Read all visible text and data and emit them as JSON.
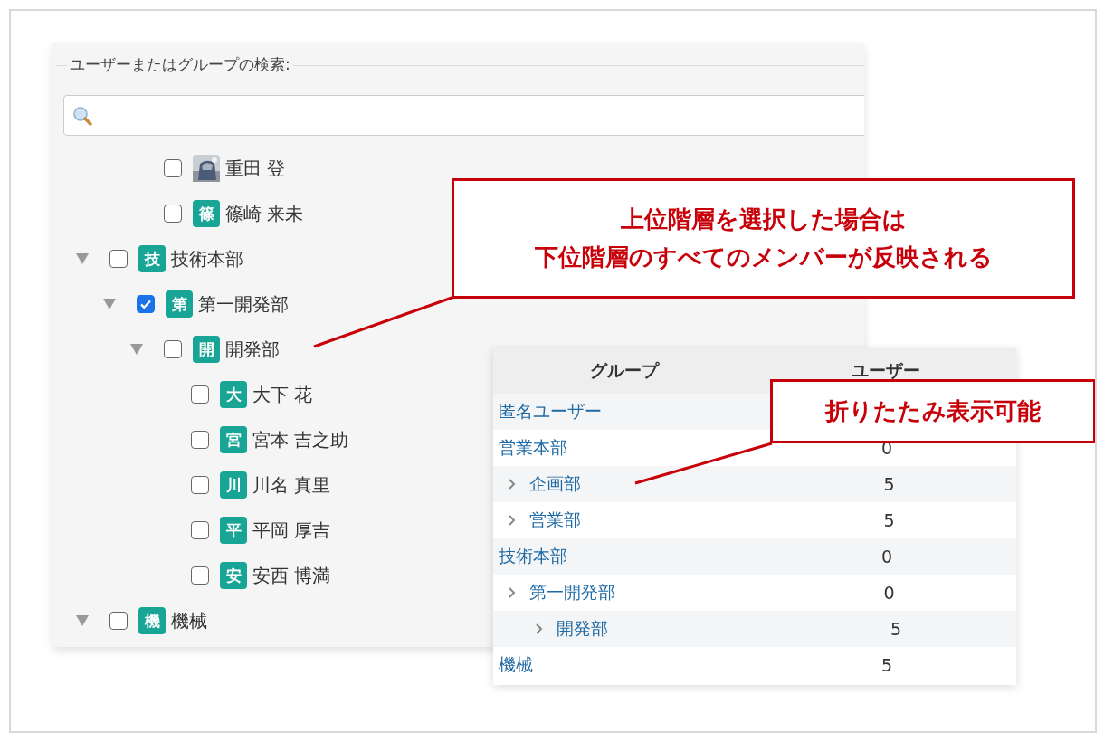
{
  "search_panel": {
    "legend": "ユーザーまたはグループの検索:",
    "tree": [
      {
        "children": [
          {
            "children": [
              {
                "label": "重田 登",
                "checked": false
              },
              {
                "label": "篠崎 来未",
                "badge": "篠",
                "checked": false
              }
            ]
          }
        ]
      },
      {
        "label": "技術本部",
        "badge": "技",
        "checked": false,
        "expanded": true,
        "children": [
          {
            "label": "第一開発部",
            "badge": "第",
            "checked": true,
            "expanded": true,
            "children": [
              {
                "label": "開発部",
                "badge": "開",
                "checked": false,
                "expanded": true,
                "children": [
                  {
                    "label": "大下 花",
                    "badge": "大",
                    "checked": false
                  },
                  {
                    "label": "宮本 吉之助",
                    "badge": "宮",
                    "checked": false
                  },
                  {
                    "label": "川名 真里",
                    "badge": "川",
                    "checked": false
                  },
                  {
                    "label": "平岡 厚吉",
                    "badge": "平",
                    "checked": false
                  },
                  {
                    "label": "安西 博満",
                    "badge": "安",
                    "checked": false
                  }
                ]
              }
            ]
          }
        ]
      },
      {
        "label": "機械",
        "badge": "機",
        "checked": false,
        "expanded": true
      }
    ]
  },
  "group_table": {
    "columns": [
      "グループ",
      "ユーザー"
    ],
    "rows": [
      {
        "group": "匿名ユーザー"
      },
      {
        "group": "営業本部",
        "users": "0",
        "children": [
          {
            "group": "企画部",
            "users": "5"
          },
          {
            "group": "営業部",
            "users": "5"
          }
        ]
      },
      {
        "group": "技術本部",
        "users": "0",
        "children": [
          {
            "group": "第一開発部",
            "users": "0",
            "children": [
              {
                "group": "開発部",
                "users": "5"
              }
            ]
          }
        ]
      },
      {
        "group": "機械",
        "users": "5"
      }
    ]
  },
  "callouts": [
    {
      "lines": [
        "上位階層を選択した場合は",
        "下位階層のすべてのメンバーが反映される"
      ]
    },
    {
      "lines": [
        "折りたたみ表示可能"
      ]
    }
  ]
}
